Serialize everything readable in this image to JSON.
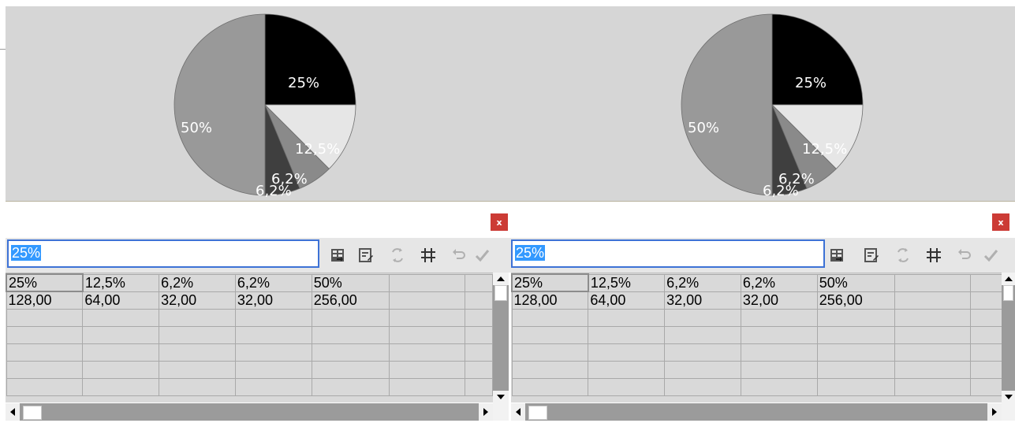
{
  "colors": {
    "chart_background": "#d6d6d6",
    "selection_highlight": "#3399ff",
    "input_border": "#3d72d6",
    "close_button": "#cc3b35"
  },
  "icons": {
    "toolbar": [
      "import-data-icon",
      "edit-data-icon",
      "switch-rows-columns-icon",
      "table-columns-icon",
      "undo-icon",
      "apply-check-icon"
    ],
    "close": "close-icon",
    "scroll": [
      "scroll-up-icon",
      "scroll-down-icon",
      "scroll-left-icon",
      "scroll-right-icon"
    ]
  },
  "panels": [
    {
      "chart_data": {
        "type": "pie",
        "slices": [
          {
            "label": "25%",
            "value": 128.0,
            "color": "#000000"
          },
          {
            "label": "12,5%",
            "value": 64.0,
            "color": "#e6e6e6"
          },
          {
            "label": "6,2%",
            "value": 32.0,
            "color": "#8a8a8a"
          },
          {
            "label": "6,2%",
            "value": 32.0,
            "color": "#3f3f3f"
          },
          {
            "label": "50%",
            "value": 256.0,
            "color": "#999999"
          }
        ]
      },
      "close_label": "x",
      "edit_input": {
        "value": "25%"
      },
      "grid": {
        "rows": [
          [
            "25%",
            "12,5%",
            "6,2%",
            "6,2%",
            "50%",
            "",
            ""
          ],
          [
            "128,00",
            "64,00",
            "32,00",
            "32,00",
            "256,00",
            "",
            ""
          ],
          [
            "",
            "",
            "",
            "",
            "",
            "",
            ""
          ],
          [
            "",
            "",
            "",
            "",
            "",
            "",
            ""
          ],
          [
            "",
            "",
            "",
            "",
            "",
            "",
            ""
          ],
          [
            "",
            "",
            "",
            "",
            "",
            "",
            ""
          ],
          [
            "",
            "",
            "",
            "",
            "",
            "",
            ""
          ]
        ]
      }
    },
    {
      "chart_data": {
        "type": "pie",
        "slices": [
          {
            "label": "25%",
            "value": 128.0,
            "color": "#000000"
          },
          {
            "label": "12,5%",
            "value": 64.0,
            "color": "#e6e6e6"
          },
          {
            "label": "6,2%",
            "value": 32.0,
            "color": "#8a8a8a"
          },
          {
            "label": "6,2%",
            "value": 32.0,
            "color": "#3f3f3f"
          },
          {
            "label": "50%",
            "value": 256.0,
            "color": "#999999"
          }
        ]
      },
      "close_label": "x",
      "edit_input": {
        "value": "25%"
      },
      "grid": {
        "rows": [
          [
            "25%",
            "12,5%",
            "6,2%",
            "6,2%",
            "50%",
            "",
            ""
          ],
          [
            "128,00",
            "64,00",
            "32,00",
            "32,00",
            "256,00",
            "",
            ""
          ],
          [
            "",
            "",
            "",
            "",
            "",
            "",
            ""
          ],
          [
            "",
            "",
            "",
            "",
            "",
            "",
            ""
          ],
          [
            "",
            "",
            "",
            "",
            "",
            "",
            ""
          ],
          [
            "",
            "",
            "",
            "",
            "",
            "",
            ""
          ],
          [
            "",
            "",
            "",
            "",
            "",
            "",
            ""
          ]
        ]
      }
    }
  ]
}
